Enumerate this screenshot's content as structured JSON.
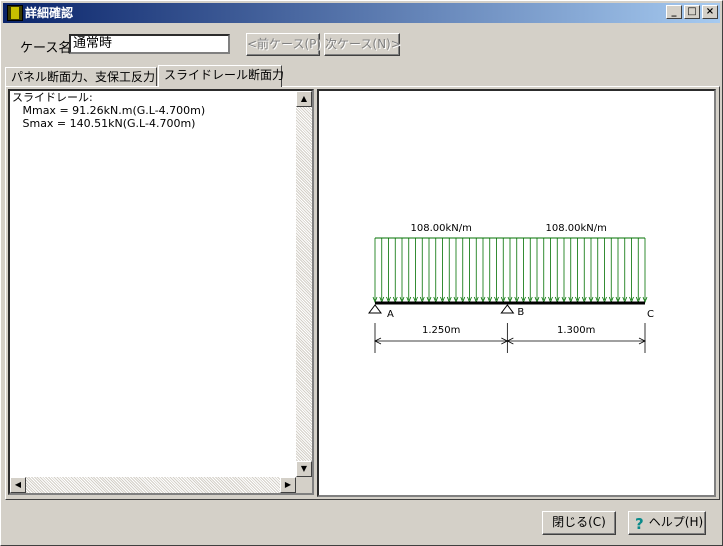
{
  "window": {
    "title": "詳細確認"
  },
  "case": {
    "label": "ケース名",
    "value": "通常時",
    "prev_button": "<前ケース(P)",
    "next_button": "次ケース(N)>"
  },
  "tabs": [
    {
      "label": "パネル断面力、支保工反力"
    },
    {
      "label": "スライドレール断面力"
    }
  ],
  "text": {
    "lines": [
      "スライドレール:",
      "   Mmax = 91.26kN.m(G.L-4.700m)",
      "   Smax = 140.51kN(G.L-4.700m)"
    ]
  },
  "diagram": {
    "load_left": "108.00kN/m",
    "load_right": "108.00kN/m",
    "support_a": "A",
    "support_b": "B",
    "support_c": "C",
    "span_ab": "1.250m",
    "span_bc": "1.300m",
    "span_ab_value": 1.25,
    "span_bc_value": 1.3,
    "load_color": "#007000",
    "beam_color": "#000000"
  },
  "footer": {
    "close_button": "閉じる(C)",
    "help_button": "ヘルプ(H)"
  }
}
